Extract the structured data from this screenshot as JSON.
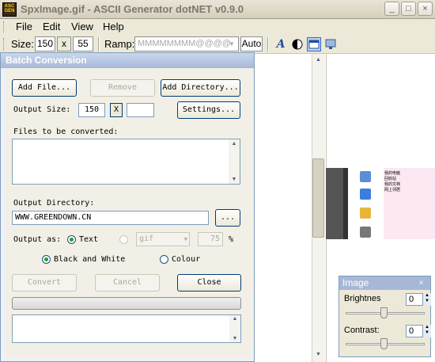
{
  "window": {
    "title": "SpxImage.gif - ASCII Generator dotNET v0.9.0",
    "icon_text": "ASC GEN",
    "minimize_glyph": "_",
    "maximize_glyph": "□",
    "close_glyph": "×"
  },
  "menu": [
    "File",
    "Edit",
    "View",
    "Help"
  ],
  "toolbar": {
    "size_label": "Size:",
    "width": "150",
    "x_button": "x",
    "height": "55",
    "ramp_label": "Ramp:",
    "ramp_value": "MMMMMMMM@@@@",
    "auto_button": "Auto",
    "icons": [
      "font-icon",
      "contrast-icon",
      "display-icon",
      "monitor-icon"
    ]
  },
  "preview_thumbnail": {
    "labels": [
      "我的电脑",
      "回收站",
      "我的文档",
      "网上邻居"
    ]
  },
  "image_panel": {
    "title": "Image",
    "brightness_label": "Brightnes",
    "brightness_value": "0",
    "contrast_label": "Contrast:",
    "contrast_value": "0",
    "close_glyph": "×"
  },
  "dialog": {
    "title": "Batch Conversion",
    "add_file_button": "Add File...",
    "remove_button": "Remove",
    "add_directory_button": "Add Directory...",
    "output_size_label": "Output Size:",
    "output_width": "150",
    "x_button": "X",
    "output_height": "",
    "settings_button": "Settings...",
    "files_label": "Files to be converted:",
    "output_directory_label": "Output Directory:",
    "output_directory_value": "WWW.GREENDOWN.CN",
    "browse_button": "...",
    "output_as_label": "Output as:",
    "text_option": "Text",
    "image_format": "gif",
    "image_quality": "75",
    "percent_sign": "%",
    "black_white_option": "Black and White",
    "colour_option": "Colour",
    "convert_button": "Convert",
    "cancel_button": "Cancel",
    "close_button": "Close",
    "output_as_selected": "text",
    "color_mode_selected": "black_and_white"
  }
}
